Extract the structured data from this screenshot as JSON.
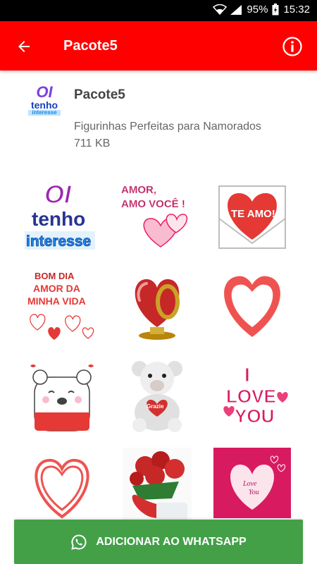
{
  "status_bar": {
    "battery": "95%",
    "time": "15:32"
  },
  "app_bar": {
    "title": "Pacote5"
  },
  "pack": {
    "name": "Pacote5",
    "publisher": "Figurinhas Perfeitas para Namorados",
    "size": "711 KB"
  },
  "tray_icon": {
    "line1": "OI",
    "line2": "tenho",
    "line3": "interesse"
  },
  "stickers": [
    {
      "name": "oi-tenho-interesse",
      "lines": [
        "OI",
        "tenho",
        "interesse"
      ]
    },
    {
      "name": "amor-amo-voce",
      "lines": [
        "AMOR,",
        "AMO VOCÊ !"
      ]
    },
    {
      "name": "te-amo-envelope",
      "lines": [
        "TE AMO!"
      ]
    },
    {
      "name": "bom-dia-amor",
      "lines": [
        "BOM DIA",
        "AMOR DA",
        "MINHA VIDA"
      ]
    },
    {
      "name": "red-heart-ring",
      "lines": []
    },
    {
      "name": "outline-heart",
      "lines": []
    },
    {
      "name": "bear-kisses",
      "lines": []
    },
    {
      "name": "teddy-bear-grazie",
      "lines": [
        "Grazie"
      ]
    },
    {
      "name": "i-love-you",
      "lines": [
        "I",
        "LOVE",
        "YOU"
      ]
    },
    {
      "name": "double-outline-heart",
      "lines": []
    },
    {
      "name": "roses-bouquet",
      "lines": []
    },
    {
      "name": "love-you-card",
      "lines": [
        "Love",
        "You"
      ]
    }
  ],
  "add_button": {
    "label": "ADICIONAR AO WHATSAPP"
  }
}
